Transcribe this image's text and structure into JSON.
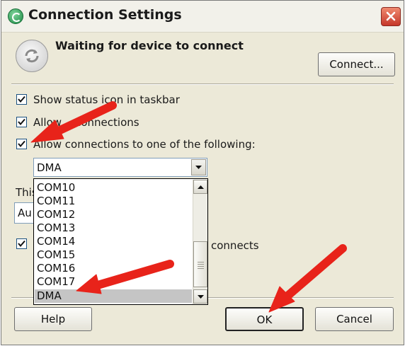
{
  "window": {
    "title": "Connection Settings"
  },
  "icons": {
    "title": "connection-sync-icon",
    "close": "close-icon",
    "status": "sync-arrows-icon",
    "check": "checkmark-icon",
    "dropdown": "chevron-down-icon",
    "scroll_up": "scroll-up-icon",
    "scroll_down": "scroll-down-icon"
  },
  "status": {
    "heading": "Waiting for device to connect"
  },
  "buttons": {
    "connect": "Connect...",
    "help": "Help",
    "ok": "OK",
    "cancel": "Cancel"
  },
  "checkboxes": [
    {
      "label": "Show status icon in taskbar",
      "checked": true
    },
    {
      "label": "Allow    connections",
      "checked": true
    },
    {
      "label": "Allow connections to one of the following:",
      "checked": true
    },
    {
      "label": "connects",
      "checked": true
    }
  ],
  "connection_combo": {
    "selected": "DMA",
    "options": [
      "COM10",
      "COM11",
      "COM12",
      "COM13",
      "COM14",
      "COM15",
      "COM16",
      "COM17",
      "DMA"
    ],
    "highlighted": "DMA"
  },
  "partial": {
    "this_label": "This",
    "au_value": "Au"
  },
  "colors": {
    "annotation_arrow": "#e8231a",
    "dialog_bg": "#ece9d8",
    "close_button": "#d9523d"
  }
}
